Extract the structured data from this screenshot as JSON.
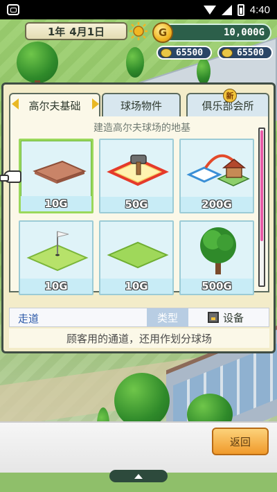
{
  "status_bar": {
    "time": "4:40"
  },
  "hud": {
    "date": {
      "year": "1年",
      "date": "4月1日"
    },
    "money": "10,000G",
    "coin_symbol": "G",
    "stat_left": "65500",
    "stat_right": "65500"
  },
  "panel": {
    "tabs": [
      {
        "label": "高尔夫基础",
        "active": true
      },
      {
        "label": "球场物件",
        "active": false
      },
      {
        "label": "俱乐部会所",
        "active": false,
        "badge": "新"
      }
    ],
    "section_title": "建造高尔夫球场的地基",
    "items": [
      {
        "name": "path",
        "price": "10G",
        "selected": true
      },
      {
        "name": "demolish",
        "price": "50G",
        "selected": false
      },
      {
        "name": "relocate",
        "price": "200G",
        "selected": false
      },
      {
        "name": "green",
        "price": "10G",
        "selected": false
      },
      {
        "name": "fairway",
        "price": "10G",
        "selected": false
      },
      {
        "name": "tree",
        "price": "500G",
        "selected": false
      }
    ],
    "detail": {
      "name": "走道",
      "type_label": "类型",
      "category_label": "设备",
      "description": "顾客用的通道，还用作划分球场"
    }
  },
  "bottom": {
    "back_label": "返回"
  },
  "colors": {
    "accent_green": "#9ad85b",
    "button_orange": "#f09a2b",
    "scroll_pink": "#e85aa6",
    "money_bg": "#2c5f4a"
  }
}
